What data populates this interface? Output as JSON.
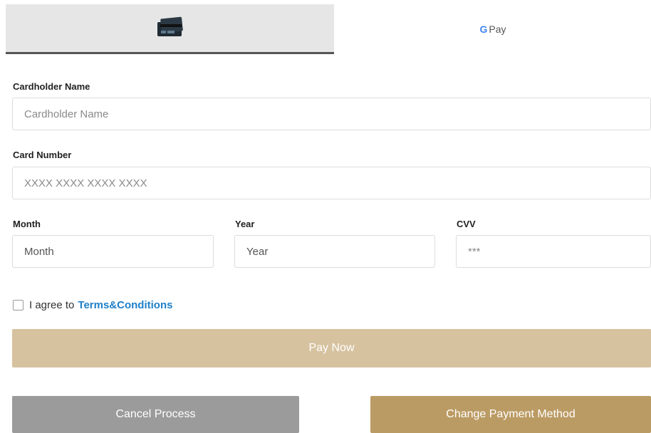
{
  "tabs": {
    "card_icon": "credit-card-icon",
    "gpay_g": "G",
    "gpay_label": "Pay"
  },
  "form": {
    "cardholder": {
      "label": "Cardholder Name",
      "placeholder": "Cardholder Name"
    },
    "card_number": {
      "label": "Card Number",
      "placeholder": "XXXX XXXX XXXX XXXX"
    },
    "month": {
      "label": "Month",
      "value": "Month"
    },
    "year": {
      "label": "Year",
      "value": "Year"
    },
    "cvv": {
      "label": "CVV",
      "placeholder": "***"
    }
  },
  "agree": {
    "prefix": "I agree to",
    "link": "Terms&Conditions"
  },
  "buttons": {
    "pay": "Pay Now",
    "cancel": "Cancel Process",
    "change": "Change Payment Method"
  },
  "colors": {
    "pay": "#d6c29f",
    "cancel": "#9b9b9b",
    "change": "#bb9b64",
    "link": "#1e7fc8"
  }
}
